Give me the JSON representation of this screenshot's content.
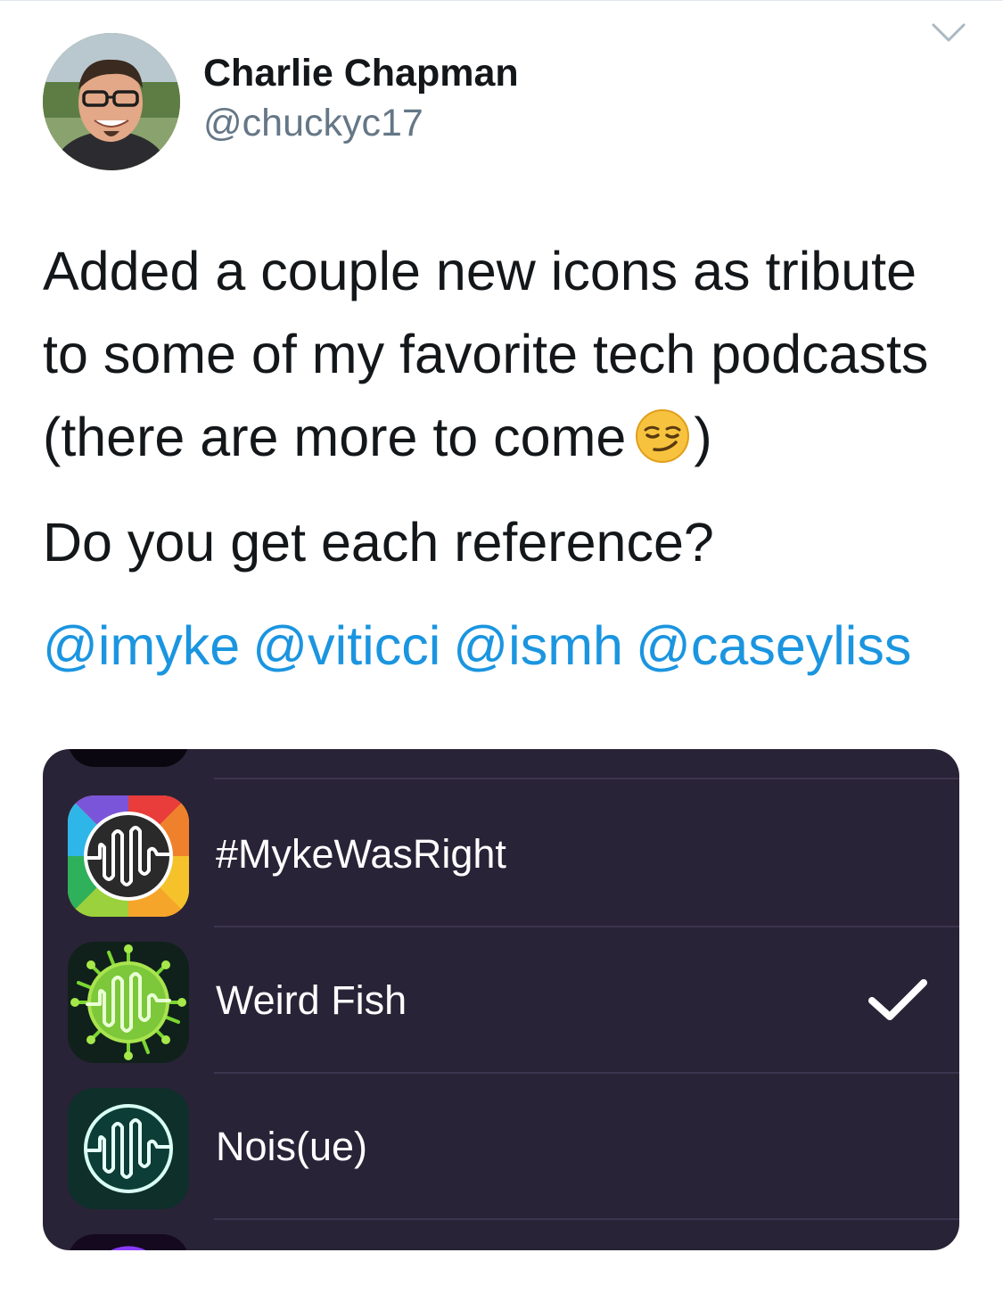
{
  "tweet": {
    "author_name": "Charlie Chapman",
    "author_handle": "@chuckyc17",
    "lines": [
      "Added a couple new icons as tribute",
      "to some of my favorite tech podcasts",
      "(there are more to come",
      ")"
    ],
    "question": "Do you get each reference?",
    "mentions": [
      "@imyke",
      "@viticci",
      "@ismh",
      "@caseyliss"
    ]
  },
  "icons": {
    "menu": "chevron-down-icon",
    "emoji": "smirking-face-emoji",
    "selected": "checkmark-icon"
  },
  "colors": {
    "link": "#1b95e0",
    "card_background": "#292337",
    "handle": "#657786"
  },
  "icon_list": {
    "items": [
      {
        "label": "#MykeWasRight",
        "icon": "rainbow-waveform-icon",
        "selected": false
      },
      {
        "label": "Weird Fish",
        "icon": "virus-waveform-icon",
        "selected": true
      },
      {
        "label": "Nois(ue)",
        "icon": "teal-waveform-icon",
        "selected": false
      }
    ]
  }
}
